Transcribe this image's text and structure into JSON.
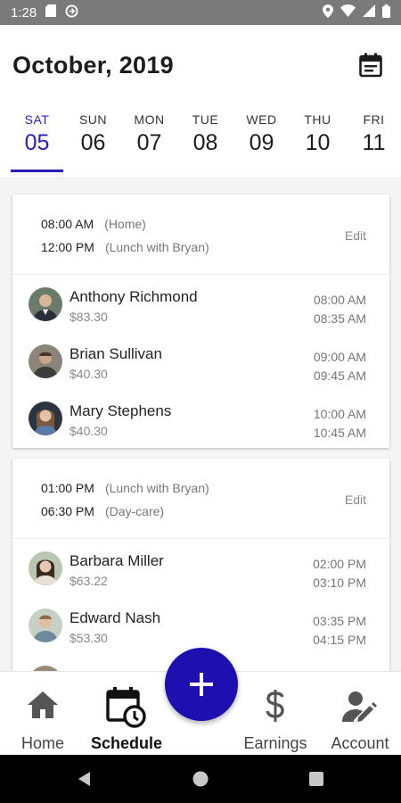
{
  "status_bar": {
    "time": "1:28",
    "icons": [
      "sd-card-icon",
      "sync-icon",
      "location-icon",
      "wifi-icon",
      "signal-icon",
      "battery-icon"
    ]
  },
  "header": {
    "title": "October,  2019",
    "calendar_icon": "calendar-icon"
  },
  "days": [
    {
      "name": "SAT",
      "num": "05",
      "active": true
    },
    {
      "name": "SUN",
      "num": "06"
    },
    {
      "name": "MON",
      "num": "07"
    },
    {
      "name": "TUE",
      "num": "08"
    },
    {
      "name": "WED",
      "num": "09"
    },
    {
      "name": "THU",
      "num": "10"
    },
    {
      "name": "FRI",
      "num": "11"
    }
  ],
  "schedules": [
    {
      "start_time": "08:00 AM",
      "start_place": "(Home)",
      "end_time": "12:00 PM",
      "end_place": "(Lunch with Bryan)",
      "edit_label": "Edit",
      "riders": [
        {
          "name": "Anthony Richmond",
          "price": "$83.30",
          "pickup": "08:00 AM",
          "dropoff": "08:35 AM"
        },
        {
          "name": "Brian Sullivan",
          "price": "$40.30",
          "pickup": "09:00 AM",
          "dropoff": "09:45 AM"
        },
        {
          "name": "Mary Stephens",
          "price": "$40.30",
          "pickup": "10:00 AM",
          "dropoff": "10:45 AM"
        }
      ]
    },
    {
      "start_time": "01:00 PM",
      "start_place": "(Lunch with Bryan)",
      "end_time": "06:30 PM",
      "end_place": "(Day-care)",
      "edit_label": "Edit",
      "riders": [
        {
          "name": "Barbara Miller",
          "price": "$63.22",
          "pickup": "02:00 PM",
          "dropoff": "03:10 PM"
        },
        {
          "name": "Edward Nash",
          "price": "$53.30",
          "pickup": "03:35 PM",
          "dropoff": "04:15 PM"
        }
      ]
    }
  ],
  "bottom_nav": {
    "home": "Home",
    "schedule": "Schedule",
    "earnings": "Earnings",
    "account": "Account",
    "active": "schedule"
  },
  "fab": {
    "icon": "plus-icon"
  },
  "colors": {
    "accent": "#2a1fb8",
    "fab": "#1d0fb0",
    "status_bar": "#7a7a7a"
  }
}
